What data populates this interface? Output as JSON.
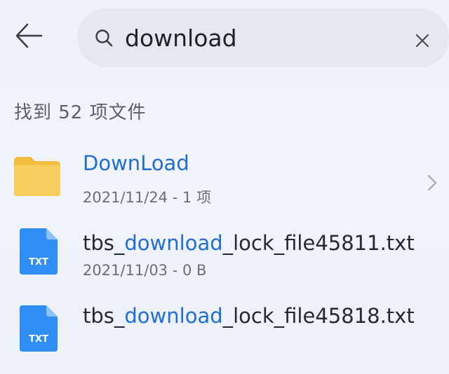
{
  "search": {
    "query": "download",
    "placeholder": ""
  },
  "results": {
    "count_text": "找到 52 项文件"
  },
  "items": [
    {
      "type": "folder",
      "icon": "folder-icon",
      "name": "DownLoad",
      "meta": "2021/11/24 - 1 项"
    },
    {
      "type": "txt",
      "icon": "txt-file-icon",
      "icon_label": "TXT",
      "name_prefix": "tbs_",
      "name_match": "download",
      "name_suffix": "_lock_file45811.txt",
      "meta": "2021/11/03 - 0 B"
    },
    {
      "type": "txt",
      "icon": "txt-file-icon",
      "icon_label": "TXT",
      "name_prefix": "tbs_",
      "name_match": "download",
      "name_suffix": "_lock_file45818.txt",
      "meta": ""
    }
  ],
  "colors": {
    "accent": "#1f6ed8",
    "folder": "#f7cc5a",
    "txt_icon": "#2f8ef4"
  }
}
